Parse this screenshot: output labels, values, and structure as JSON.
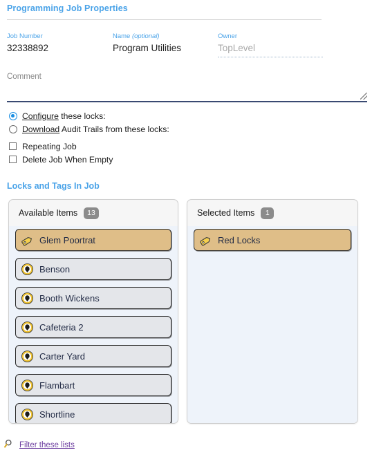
{
  "page": {
    "title": "Programming Job Properties",
    "section_heading": "Locks and Tags In Job"
  },
  "fields": {
    "job_number": {
      "label": "Job Number",
      "value": "32338892"
    },
    "name": {
      "label": "Name ",
      "label_optional": "(optional)",
      "value": "Program Utilities"
    },
    "owner": {
      "label": "Owner",
      "value": "TopLevel"
    }
  },
  "comment": {
    "label": "Comment",
    "value": ""
  },
  "radios": [
    {
      "label_underlined": "Configure",
      "label_rest": " these locks:",
      "checked": true
    },
    {
      "label_underlined": "Download",
      "label_rest": " Audit Trails from these locks:",
      "checked": false
    }
  ],
  "checkboxes": [
    {
      "label": "Repeating Job",
      "checked": false
    },
    {
      "label": "Delete Job When Empty",
      "checked": false
    }
  ],
  "panels": {
    "available": {
      "title": "Available Items",
      "count": "13",
      "items": [
        {
          "label": "Glem Poortrat",
          "icon": "tag-icon",
          "type": "tag"
        },
        {
          "label": "Benson",
          "icon": "lock-icon",
          "type": "lock"
        },
        {
          "label": "Booth Wickens",
          "icon": "lock-icon",
          "type": "lock"
        },
        {
          "label": "Cafeteria 2",
          "icon": "lock-icon",
          "type": "lock"
        },
        {
          "label": "Carter Yard",
          "icon": "lock-icon",
          "type": "lock"
        },
        {
          "label": "Flambart",
          "icon": "lock-icon",
          "type": "lock"
        },
        {
          "label": "Shortline",
          "icon": "lock-icon",
          "type": "lock"
        }
      ]
    },
    "selected": {
      "title": "Selected Items",
      "count": "1",
      "items": [
        {
          "label": "Red Locks",
          "icon": "tag-icon",
          "type": "tag"
        }
      ]
    }
  },
  "footer": {
    "filter_link": "Filter these lists",
    "filter_icon": "magnifier-icon"
  },
  "colors": {
    "accent_blue": "#4aa3e8",
    "radio_blue": "#1a8fe3",
    "tag_gold": "#dfbe88",
    "badge_gray": "#8b8b8b",
    "link_purple": "#6d3fa0"
  }
}
